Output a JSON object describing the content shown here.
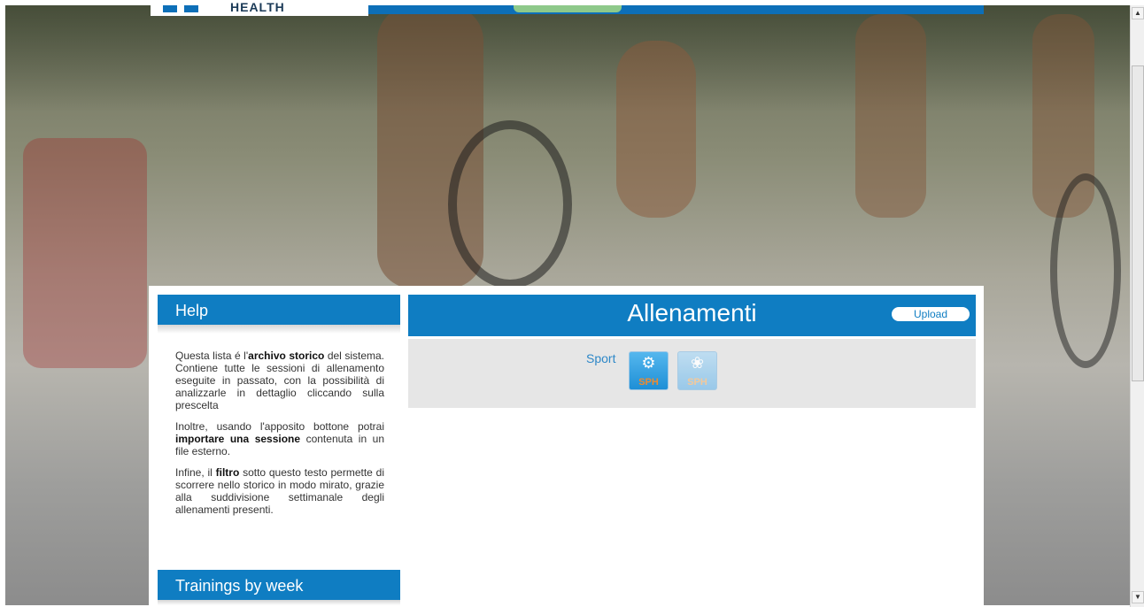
{
  "header": {
    "logo_text": "HEALTH"
  },
  "help": {
    "title": "Help",
    "p1_a": "Questa lista é l'",
    "p1_b": "archivo storico",
    "p1_c": " del sistema. Contiene tutte le sessioni di allenamento eseguite in passato, con la possibilità di analizzarle in dettaglio cliccando sulla prescelta",
    "p2_a": "Inoltre, usando l'apposito bottone potrai ",
    "p2_b": "importare una sessione",
    "p2_c": " contenuta in un file esterno.",
    "p3_a": "Infine, il ",
    "p3_b": "filtro",
    "p3_c": " sotto questo testo permette di scorrere nello storico in modo mirato, grazie alla suddivisione settimanale degli allenamenti presenti."
  },
  "trainings_by_week": {
    "title": "Trainings by week"
  },
  "main": {
    "title": "Allenamenti",
    "upload_label": "Upload",
    "sport_label": "Sport",
    "sports": [
      {
        "icon": "cycling-icon",
        "badge": "SPH"
      },
      {
        "icon": "running-icon",
        "badge": "SPH"
      }
    ]
  },
  "colors": {
    "accent": "#0f7dc2",
    "sph_badge": "#f08a2c"
  }
}
